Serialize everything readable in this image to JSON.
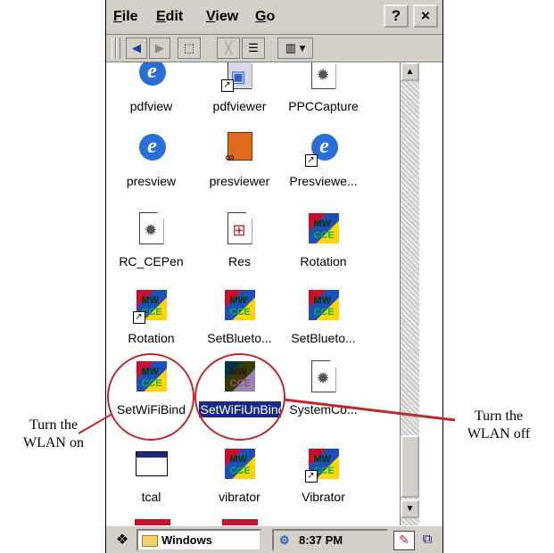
{
  "menubar": {
    "file": "File",
    "edit": "Edit",
    "view": "View",
    "go": "Go",
    "help": "?",
    "close": "×"
  },
  "toolbar": {
    "back": "◀",
    "forward": "▶",
    "up": "⬚",
    "delete": "╳",
    "properties": "☰",
    "views": "▥ ▾"
  },
  "files": [
    {
      "label": "pdfview",
      "icon": "ie-icon"
    },
    {
      "label": "pdfviewer",
      "icon": "pdf-shortcut-icon"
    },
    {
      "label": "PPCCapture",
      "icon": "gear-page-icon"
    },
    {
      "label": "presview",
      "icon": "ie-icon"
    },
    {
      "label": "presviewer",
      "icon": "presentation-icon"
    },
    {
      "label": "Presviewe...",
      "icon": "ie-shortcut-icon"
    },
    {
      "label": "RC_CEPen",
      "icon": "gear-page-icon"
    },
    {
      "label": "Res",
      "icon": "windows-page-icon"
    },
    {
      "label": "Rotation",
      "icon": "cube-icon"
    },
    {
      "label": "Rotation",
      "icon": "cube-shortcut-icon"
    },
    {
      "label": "SetBlueto...",
      "icon": "cube-icon"
    },
    {
      "label": "SetBlueto...",
      "icon": "cube-icon"
    },
    {
      "label": "SetWiFiBind",
      "icon": "cube-icon"
    },
    {
      "label": "SetWiFiUnBind",
      "icon": "cube-icon"
    },
    {
      "label": "SystemCo...",
      "icon": "gear-page-icon"
    },
    {
      "label": "tcal",
      "icon": "window-icon"
    },
    {
      "label": "vibrator",
      "icon": "cube-icon"
    },
    {
      "label": "Vibrator",
      "icon": "cube-shortcut-icon"
    }
  ],
  "taskbar": {
    "window": "Windows",
    "time": "8:37 PM"
  },
  "annotations": {
    "on": "Turn the WLAN on",
    "off": "Turn the WLAN off"
  },
  "colors": {
    "highlight": "#c0282d",
    "selection": "#1a2a85",
    "chrome": "#d4d0c8"
  }
}
